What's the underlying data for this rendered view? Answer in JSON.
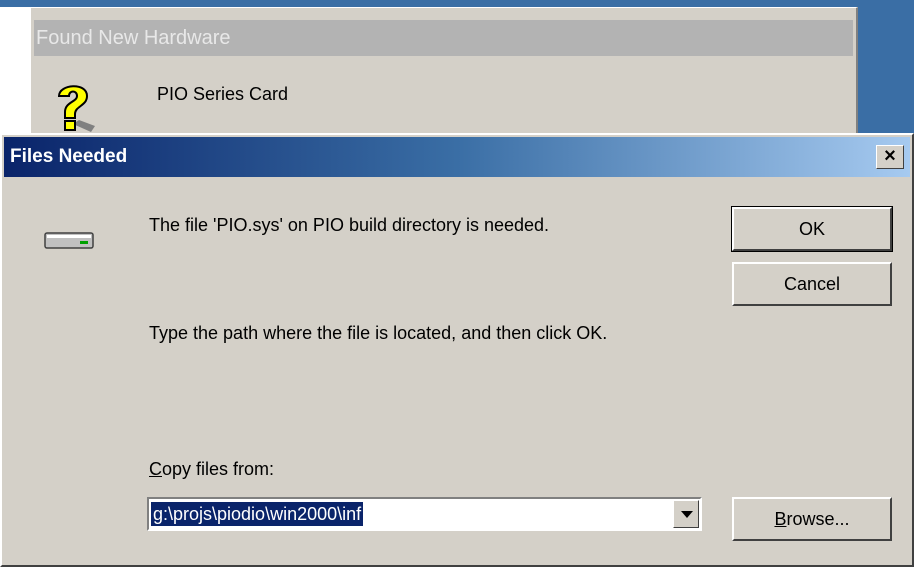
{
  "background_window": {
    "title": "Found New Hardware",
    "device_name": "PIO Series Card",
    "icon": "question-mark-icon"
  },
  "dialog": {
    "title": "Files Needed",
    "close_label": "×",
    "icon": "drive-icon",
    "message": "The file 'PIO.sys' on PIO build directory is needed.",
    "instruction": "Type the path where the file is located, and then click OK.",
    "copy_label_prefix": "",
    "copy_label_underlined": "C",
    "copy_label_rest": "opy files from:",
    "copy_path": "g:\\projs\\piodio\\win2000\\inf",
    "buttons": {
      "ok": "OK",
      "cancel": "Cancel",
      "browse_underlined": "B",
      "browse_rest": "rowse..."
    }
  },
  "colors": {
    "face": "#d4d0c8",
    "title_active_start": "#0a246a",
    "title_active_end": "#a6caf0",
    "title_inactive": "#b3b3b3",
    "selection": "#0a246a",
    "desktop": "#3a6ea5"
  }
}
